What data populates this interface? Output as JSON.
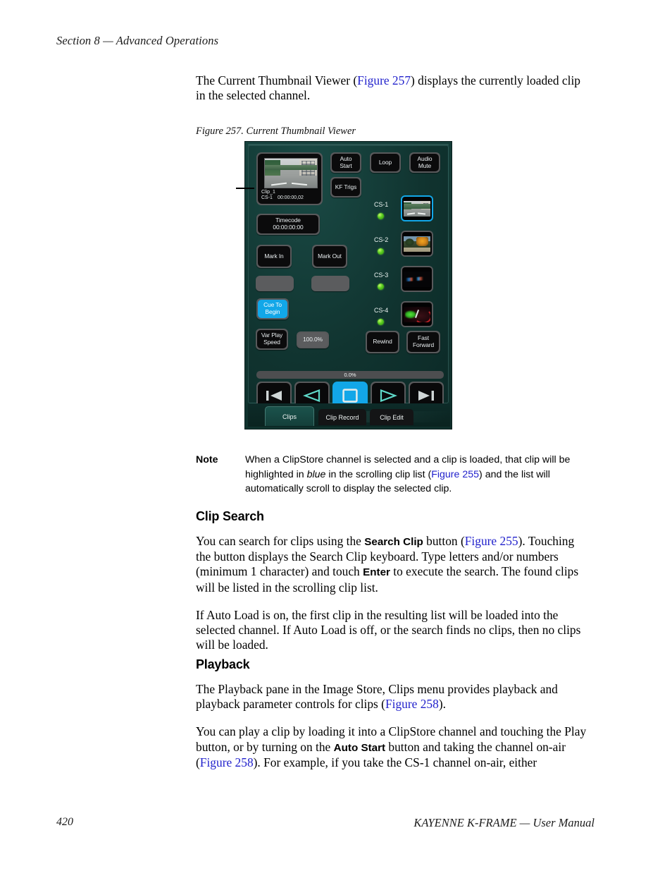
{
  "page": {
    "running_head": "Section 8 — Advanced Operations",
    "footer_page_number": "420",
    "footer_title": "KAYENNE K-FRAME  —  User Manual",
    "link_color": "#2222cc"
  },
  "content": {
    "intro_p1_a": "The Current Thumbnail Viewer (",
    "intro_p1_link": "Figure 257",
    "intro_p1_b": ") displays the currently loaded clip in the selected channel.",
    "figure_caption": "Figure 257.  Current Thumbnail Viewer",
    "note": {
      "label": "Note",
      "a": "When a ClipStore channel is selected and a clip is loaded, that clip will be highlighted in ",
      "em": "blue",
      "b": " in the scrolling clip list (",
      "link": "Figure 255",
      "c": ") and the list will automatically scroll to display the selected clip."
    },
    "clip_search": {
      "heading": "Clip Search",
      "p1_a": "You can search for clips using the ",
      "p1_b1": "Search Clip",
      "p1_c": " button (",
      "p1_link": "Figure 255",
      "p1_d": "). Touching the button displays the Search Clip keyboard. Type letters and/or numbers (minimum 1 character) and touch ",
      "p1_b2": "Enter",
      "p1_e": " to execute the search. The found clips will be listed in the scrolling clip list.",
      "p2": "If Auto Load is on, the first clip in the resulting list will be loaded into the selected channel. If Auto Load is off, or the search finds no clips, then no clips will be loaded."
    },
    "playback": {
      "heading": "Playback",
      "p1_a": "The Playback pane in the Image Store, Clips menu provides playback and playback parameter controls for clips (",
      "p1_link": "Figure 258",
      "p1_b": ").",
      "p2_a": "You can play a clip by loading it into a ClipStore channel and touching the Play button, or by turning on the ",
      "p2_bold": "Auto Start",
      "p2_b": " button and taking the channel on-air (",
      "p2_link": "Figure 258",
      "p2_c": "). For example, if you take the CS-1 channel on-air, either"
    }
  },
  "figure_ui": {
    "current_thumbnail": {
      "clip_name": "Clip_1",
      "channel": "CS-1",
      "timecode": "00:00:00,02"
    },
    "buttons": {
      "auto_start": "Auto\nStart",
      "auto_start_l1": "Auto",
      "auto_start_l2": "Start",
      "loop": "Loop",
      "audio_mute_l1": "Audio",
      "audio_mute_l2": "Mute",
      "kf_trigs": "KF Trigs",
      "timecode_label": "Timecode",
      "timecode_value": "00:00:00:00",
      "mark_in": "Mark In",
      "mark_out": "Mark Out",
      "cue_to_begin_l1": "Cue To",
      "cue_to_begin_l2": "Begin",
      "var_play_speed_l1": "Var Play",
      "var_play_speed_l2": "Speed",
      "var_play_speed_value": "100.0%",
      "rewind": "Rewind",
      "fast_forward_l1": "Fast",
      "fast_forward_l2": "Forward"
    },
    "progress_value": "0.0%",
    "channels": [
      {
        "label": "CS-1",
        "selected": true,
        "led": "on"
      },
      {
        "label": "CS-2",
        "selected": false,
        "led": "on"
      },
      {
        "label": "CS-3",
        "selected": false,
        "led": "on"
      },
      {
        "label": "CS-4",
        "selected": false,
        "led": "on"
      }
    ],
    "transport": [
      {
        "name": "jump-to-start",
        "active": false
      },
      {
        "name": "play-reverse",
        "active": false
      },
      {
        "name": "stop",
        "active": true
      },
      {
        "name": "play-forward",
        "active": false
      },
      {
        "name": "jump-to-end",
        "active": false
      }
    ],
    "tabs": [
      {
        "label": "Clips",
        "active": true
      },
      {
        "label": "Clip Record",
        "active": false
      },
      {
        "label": "Clip Edit",
        "active": false
      }
    ],
    "colors": {
      "panel_teal": "#123732",
      "accent_blue": "#12a7e8",
      "button_face": "#0b0b0c",
      "button_bevel": "#58595b",
      "led_green": "#58cc1f"
    }
  }
}
